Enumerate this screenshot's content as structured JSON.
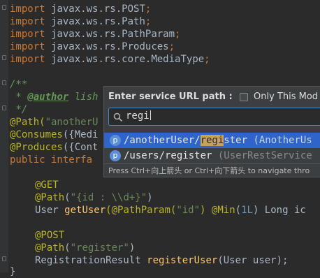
{
  "editor": {
    "imports": [
      {
        "kw": "import",
        "pkg": "javax.ws.rs.",
        "cls": "POST",
        "end": ";"
      },
      {
        "kw": "import",
        "pkg": "javax.ws.rs.",
        "cls": "Path",
        "end": ";"
      },
      {
        "kw": "import",
        "pkg": "javax.ws.rs.",
        "cls": "PathParam",
        "end": ";"
      },
      {
        "kw": "import",
        "pkg": "javax.ws.rs.",
        "cls": "Produces",
        "end": ";"
      },
      {
        "kw": "import",
        "pkg": "javax.ws.rs.core.",
        "cls": "MediaType",
        "end": ";"
      }
    ],
    "doc_open": "/**",
    "doc_star": " * ",
    "doc_tag": "@author",
    "doc_author": " lish",
    "doc_close": " */",
    "ann_path": "@Path(",
    "ann_path_value": "\"anotherU",
    "ann_consumes": "@Consumes",
    "ann_consumes_rest": "({Medi",
    "ann_produces": "@Produces",
    "ann_produces_rest": "({Cont",
    "decl_kw": "public interfa",
    "get_ann": "@GET",
    "path_ann": "@Path",
    "path_id_value": "\"{id : \\\\d+}\"",
    "method1_ret": "User ",
    "method1_name": "getUser",
    "method1_params_a": "(@PathParam(",
    "method1_param_str": "\"id\"",
    "method1_params_b": ") ",
    "min_ann": "@Min",
    "min_open": "(",
    "min_num": "1L",
    "min_close": ") Long ic",
    "post_ann": "@POST",
    "path_register_value": "\"register\"",
    "method2_ret": "RegistrationResult ",
    "method2_name": "registerUser",
    "method2_params": "(User user);",
    "close_brace": "}"
  },
  "popup": {
    "title": "Enter service URL path :",
    "checkbox_label": "Only This Mod",
    "search_value": "regi",
    "results": [
      {
        "icon": "p",
        "prefix": "/anotherUser/",
        "match": "regi",
        "suffix": "ster",
        "hint": " (AnotherUs"
      },
      {
        "icon": "p",
        "prefix": "/users/register",
        "match": "",
        "suffix": "",
        "hint": " (UserRestService"
      }
    ],
    "footer": "Press Ctrl+向上箭头 or Ctrl+向下箭头 to navigate thro"
  }
}
